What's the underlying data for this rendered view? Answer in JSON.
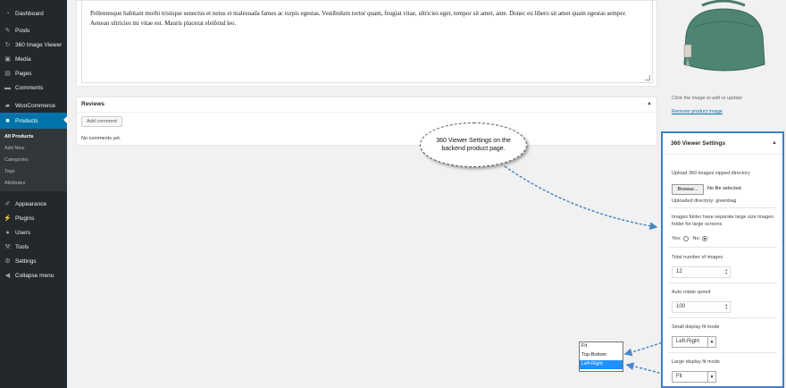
{
  "sidebar": {
    "items": [
      {
        "label": "Dashboard",
        "icon": "dashboard-icon",
        "glyph": "◔"
      },
      {
        "label": "Posts",
        "icon": "pin-icon",
        "glyph": "✎"
      },
      {
        "label": "360 Image Viewer",
        "icon": "rotate-icon",
        "glyph": "↻"
      },
      {
        "label": "Media",
        "icon": "media-icon",
        "glyph": "▣"
      },
      {
        "label": "Pages",
        "icon": "pages-icon",
        "glyph": "▤"
      },
      {
        "label": "Comments",
        "icon": "comments-icon",
        "glyph": "▬"
      },
      {
        "label": "WooCommerce",
        "icon": "woocommerce-icon",
        "glyph": "▰"
      },
      {
        "label": "Products",
        "icon": "box-icon",
        "glyph": "■"
      },
      {
        "label": "Appearance",
        "icon": "brush-icon",
        "glyph": "✐"
      },
      {
        "label": "Plugins",
        "icon": "plugin-icon",
        "glyph": "⚡"
      },
      {
        "label": "Users",
        "icon": "users-icon",
        "glyph": "●"
      },
      {
        "label": "Tools",
        "icon": "wrench-icon",
        "glyph": "⚒"
      },
      {
        "label": "Settings",
        "icon": "settings-icon",
        "glyph": "⚙"
      },
      {
        "label": "Collapse menu",
        "icon": "collapse-icon",
        "glyph": "◀"
      }
    ],
    "submenu": [
      "All Products",
      "Add New",
      "Categories",
      "Tags",
      "Attributes"
    ]
  },
  "editor": {
    "text": "Pellentesque habitant morbi tristique senectus et netus et malesuada fames ac turpis egestas. Vestibulum tortor quam, feugiat vitae, ultricies eget, tempor sit amet, ante. Donec eu libero sit amet quam egestas semper. Aenean ultricies mi vitae est. Mauris placerat eleifend leo."
  },
  "reviews": {
    "title": "Reviews",
    "add_comment": "Add comment",
    "no_comments": "No comments yet."
  },
  "product_image": {
    "hint": "Click the image to edit or update",
    "remove": "Remove product image"
  },
  "callout": {
    "text": "360 Viewer Settings on the backend product page."
  },
  "viewer_settings": {
    "title": "360 Viewer Settings",
    "upload_label": "Upload 360 images zipped directory",
    "browse_button": "Browse...",
    "file_status": "No file selected.",
    "uploaded_dir": "Uploaded directory: greenbag",
    "large_folder_label": "Images folder have separate large size images folder for large screens",
    "yes_label": "Yes:",
    "no_label": "No:",
    "total_images_label": "Total number of images",
    "total_images_value": "12",
    "speed_label": "Auto rotate speed",
    "speed_value": "100",
    "small_fit_label": "Small display fit mode",
    "small_fit_value": "Left-Right",
    "large_fit_label": "Large display fit mode",
    "large_fit_value": "Fit"
  },
  "dropdown_options": [
    "Fit",
    "Top-Bottom",
    "Left-Right"
  ],
  "colors": {
    "sidebar_bg": "#23282d",
    "accent": "#0073aa",
    "panel_highlight": "#3f7fc5",
    "dropdown_selected": "#1e90ff"
  }
}
